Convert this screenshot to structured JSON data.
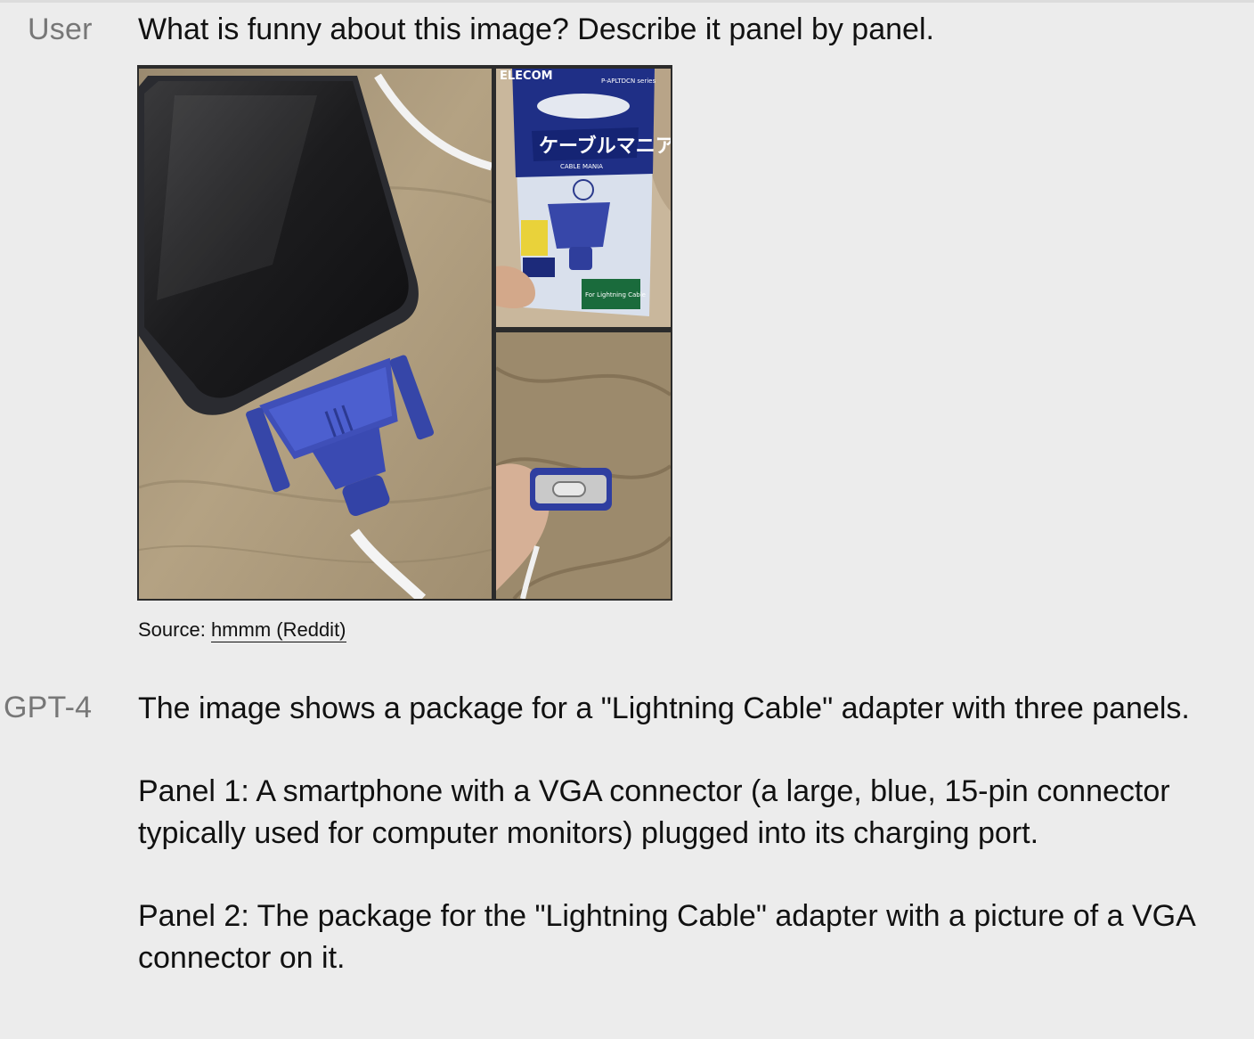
{
  "user_message": {
    "speaker": "User",
    "text": "What is funny about this image? Describe it panel by panel.",
    "image": {
      "panel_1": "smartphone with a blue VGA connector plugged into its charging port",
      "panel_2": {
        "brand": "ELECOM",
        "series": "P-APLTDCN series",
        "product_name_jp": "ケーブルマニア",
        "product_name_en": "CABLE MANIA",
        "tag": "For Lightning Cable"
      },
      "panel_3": "hand holding the adapter showing a Lightning port"
    },
    "caption_prefix": "Source: ",
    "caption_link": "hmmm (Reddit)"
  },
  "assistant_message": {
    "speaker": "GPT-4",
    "paragraphs": [
      "The image shows a package for a \"Lightning Cable\" adapter with three panels.",
      "Panel 1: A smartphone with a VGA connector (a large, blue, 15-pin connector typically used for computer monitors) plugged into its charging port.",
      "Panel 2: The package for the \"Lightning Cable\" adapter with a picture of a VGA connector on it."
    ]
  },
  "colors": {
    "background": "#ececec",
    "speaker_label": "#777777",
    "text": "#111111",
    "vga_blue": "#3f4fb8"
  }
}
